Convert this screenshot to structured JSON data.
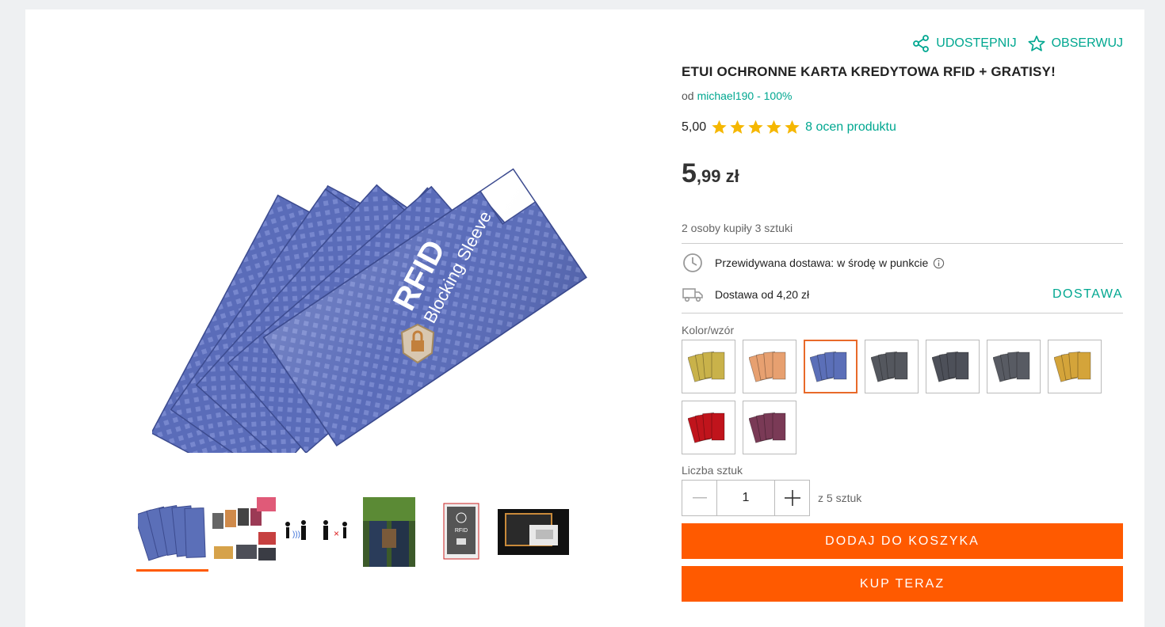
{
  "actions": {
    "share_label": "UDOSTĘPNIJ",
    "watch_label": "OBSERWUJ"
  },
  "product": {
    "title": "ETUI OCHRONNE KARTA KREDYTOWA RFID + GRATISY!",
    "seller_prefix": "od",
    "seller": "michael190 - 100%",
    "rating_value": "5,00",
    "rating_stars": 5,
    "rating_count": "8 ocen produktu",
    "price_int": "5",
    "price_dec": ",99 zł",
    "bought_info": "2 osoby kupiły 3 sztuki"
  },
  "image_text": {
    "rfid": "RFID",
    "sleeve": "Blocking Sleeve"
  },
  "delivery": {
    "expected": "Przewidywana dostawa: w środę w punkcie",
    "cost": "Dostawa od 4,20 zł",
    "link": "DOSTAWA"
  },
  "variants": {
    "label": "Kolor/wzór",
    "items": [
      {
        "color": "#c9b24a",
        "selected": false
      },
      {
        "color": "#e7a070",
        "selected": false
      },
      {
        "color": "#5b6fb8",
        "selected": true
      },
      {
        "color": "#54575e",
        "selected": false
      },
      {
        "color": "#4d5059",
        "selected": false
      },
      {
        "color": "#585b63",
        "selected": false
      },
      {
        "color": "#d4a43a",
        "selected": false
      },
      {
        "color": "#c0141c",
        "selected": false
      },
      {
        "color": "#7a3a56",
        "selected": false
      }
    ]
  },
  "quantity": {
    "label": "Liczba sztuk",
    "value": "1",
    "of_label": "z 5 sztuk"
  },
  "buttons": {
    "add_to_cart": "DODAJ DO KOSZYKA",
    "buy_now": "KUP TERAZ"
  },
  "colors": {
    "accent": "#00a790",
    "cta": "#ff5a00",
    "star": "#f5b700",
    "sleeve": "#5b6fb8"
  }
}
